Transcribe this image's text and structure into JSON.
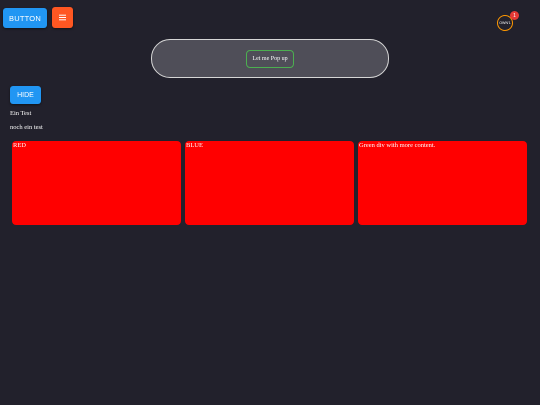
{
  "toolbar": {
    "main_button_label": "BUTTON",
    "menu_icon": "☰",
    "menu_icon_name": "hamburger-menu-icon",
    "main_button_color": "#2196f3",
    "menu_button_color": "#ff5722"
  },
  "user": {
    "avatar_text": "OWN'1",
    "badge_count": "1",
    "avatar_border_color": "#ff9800",
    "badge_color": "#e53935"
  },
  "popup": {
    "button_label": "Let me Pop up",
    "button_border_color": "#4caf50"
  },
  "controls": {
    "hide_label": "HIDE"
  },
  "texts": {
    "line1": "Ein Test",
    "line2": "noch ein test"
  },
  "cards": [
    {
      "label": "RED",
      "color": "#ff0000"
    },
    {
      "label": "BLUE",
      "color": "#ff0000"
    },
    {
      "label": "Green div with more content.",
      "color": "#ff0000"
    }
  ],
  "colors": {
    "background": "#22212c",
    "panel": "#4f4e58"
  }
}
